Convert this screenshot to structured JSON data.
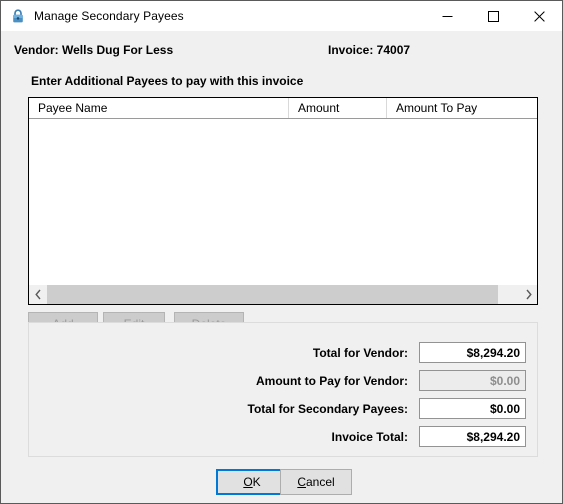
{
  "window": {
    "title": "Manage Secondary Payees",
    "icon": "padlock-icon",
    "minimize_label": "Minimize",
    "maximize_label": "Maximize",
    "close_label": "Close"
  },
  "header": {
    "vendor": "Vendor:  Wells Dug For Less",
    "invoice": "Invoice:  74007",
    "section_label": "Enter Additional Payees to pay with this invoice"
  },
  "list": {
    "columns": [
      {
        "label": "Payee Name"
      },
      {
        "label": "Amount"
      },
      {
        "label": "Amount To Pay"
      }
    ],
    "rows": [],
    "scrollbar": {
      "left_arrow": "‹",
      "right_arrow": "›"
    }
  },
  "actions": {
    "add": {
      "pre": "",
      "acc": "A",
      "post": "dd",
      "enabled": false
    },
    "edit": {
      "pre": "",
      "acc": "E",
      "post": "dit",
      "enabled": false
    },
    "delete": {
      "pre": "",
      "acc": "D",
      "post": "elete",
      "enabled": false
    }
  },
  "totals": [
    {
      "label": "Total for Vendor:",
      "value": "$8,294.20",
      "disabled": false
    },
    {
      "label": "Amount to Pay for Vendor:",
      "value": "$0.00",
      "disabled": true
    },
    {
      "label": "Total for Secondary Payees:",
      "value": "$0.00",
      "disabled": false
    },
    {
      "label": "Invoice Total:",
      "value": "$8,294.20",
      "disabled": false
    }
  ],
  "footer": {
    "ok": {
      "pre": "",
      "acc": "O",
      "post": "K"
    },
    "cancel": {
      "pre": "",
      "acc": "C",
      "post": "ancel"
    }
  },
  "colors": {
    "window_bg": "#f0f0f0",
    "titlebar_bg": "#ffffff",
    "field_bg": "#ffffff",
    "field_disabled_bg": "#ececec",
    "accent_focus": "#0078d7",
    "scrollbar_thumb": "#cdcdcd",
    "icon_blue": "#2d6a9f"
  }
}
